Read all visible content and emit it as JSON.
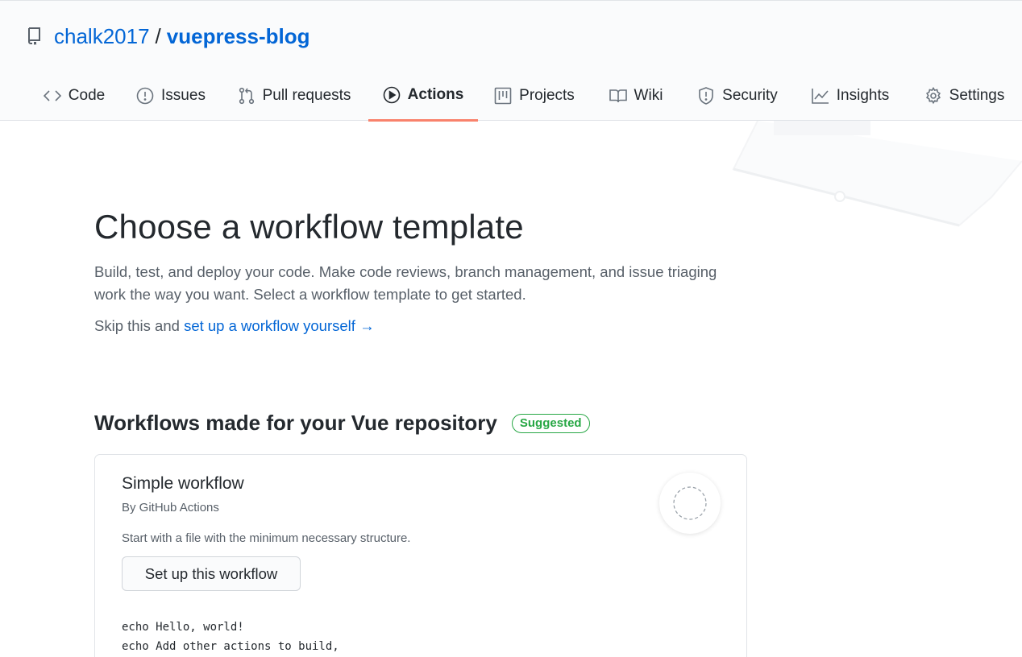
{
  "repo": {
    "owner": "chalk2017",
    "separator": "/",
    "name": "vuepress-blog"
  },
  "tabs": [
    {
      "label": "Code",
      "icon": "code-icon"
    },
    {
      "label": "Issues",
      "icon": "issue-icon"
    },
    {
      "label": "Pull requests",
      "icon": "pull-request-icon"
    },
    {
      "label": "Actions",
      "icon": "play-icon",
      "active": true
    },
    {
      "label": "Projects",
      "icon": "project-icon"
    },
    {
      "label": "Wiki",
      "icon": "book-icon"
    },
    {
      "label": "Security",
      "icon": "shield-icon"
    },
    {
      "label": "Insights",
      "icon": "graph-icon"
    },
    {
      "label": "Settings",
      "icon": "gear-icon"
    }
  ],
  "main": {
    "title": "Choose a workflow template",
    "lead": "Build, test, and deploy your code. Make code reviews, branch management, and issue triaging work the way you want. Select a workflow template to get started.",
    "skip_prefix": "Skip this and ",
    "skip_link": "set up a workflow yourself",
    "skip_arrow": "→"
  },
  "section": {
    "title": "Workflows made for your Vue repository",
    "badge": "Suggested"
  },
  "card": {
    "title": "Simple workflow",
    "by": "By GitHub Actions",
    "description": "Start with a file with the minimum necessary structure.",
    "button": "Set up this workflow",
    "code_line1": "echo Hello, world!",
    "code_line2": "echo Add other actions to build,"
  },
  "colors": {
    "link": "#0366d6",
    "active_tab_underline": "#f9826c",
    "badge_green": "#28a745"
  }
}
